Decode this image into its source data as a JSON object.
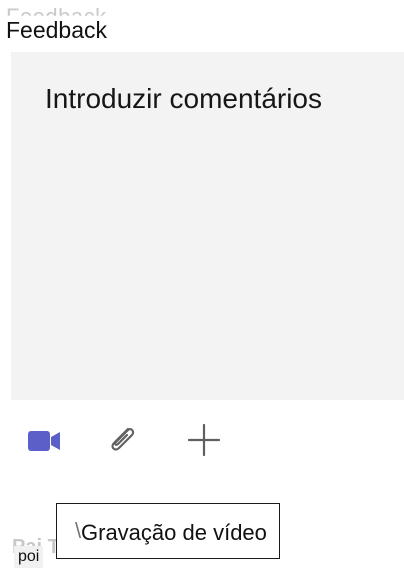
{
  "header": {
    "ghost_text": "Feedback",
    "label": "Feedback"
  },
  "comment_box": {
    "placeholder": "Introduzir comentários"
  },
  "toolbar": {
    "video_icon": "video-camera-icon",
    "attach_icon": "paperclip-icon",
    "add_icon": "plus-icon",
    "video_color": "#5b5fc7",
    "icon_color": "#616161"
  },
  "tooltip": {
    "text": "Gravação de vídeo"
  },
  "footer": {
    "ghost_text": "Pai Tu",
    "chip_text": "poi"
  }
}
